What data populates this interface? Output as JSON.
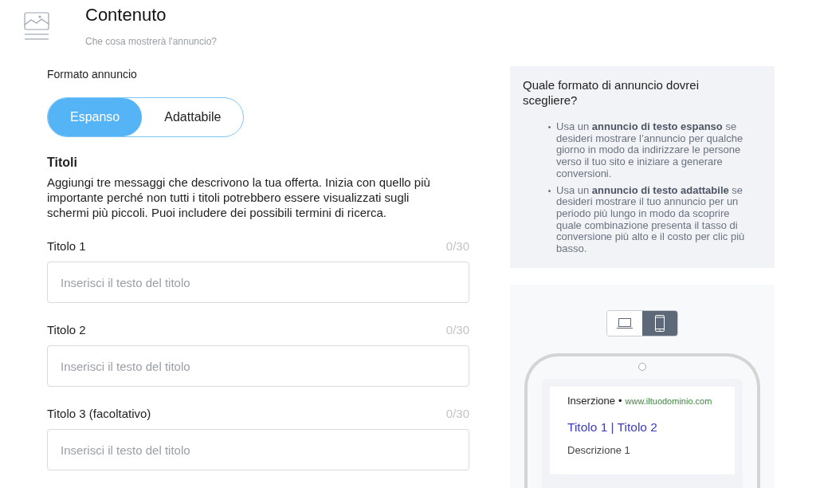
{
  "header": {
    "title": "Contenuto",
    "subtitle": "Che cosa mostrerà l'annuncio?"
  },
  "format": {
    "label": "Formato annuncio",
    "options": [
      {
        "label": "Espanso",
        "selected": true
      },
      {
        "label": "Adattabile",
        "selected": false
      }
    ]
  },
  "headlines": {
    "title": "Titoli",
    "description": "Aggiungi tre messaggi che descrivono la tua offerta. Inizia con quello più importante perché non tutti i titoli potrebbero essere visualizzati sugli schermi più piccoli. Puoi includere dei possibili termini di ricerca.",
    "fields": [
      {
        "label": "Titolo 1",
        "counter": "0/30",
        "placeholder": "Inserisci il testo del titolo"
      },
      {
        "label": "Titolo 2",
        "counter": "0/30",
        "placeholder": "Inserisci il testo del titolo"
      },
      {
        "label": "Titolo 3 (facoltativo)",
        "counter": "0/30",
        "placeholder": "Inserisci il testo del titolo"
      }
    ]
  },
  "help": {
    "title": "Quale formato di annuncio dovrei scegliere?",
    "items": [
      "Usa un **annuncio di testo espanso** se desideri mostrare l’annuncio per qualche giorno in modo da indirizzare le persone verso il tuo sito e iniziare a generare conversioni.",
      "Usa un **annuncio di testo adattabile** se desideri mostrare il tuo annuncio per un periodo più lungo in modo da scoprire quale combinazione presenta il tasso di conversione più alto e il costo per clic più basso."
    ]
  },
  "preview": {
    "devices": [
      {
        "kind": "laptop",
        "selected": false
      },
      {
        "kind": "phone",
        "selected": true
      }
    ],
    "ad": {
      "label": "Inserzione",
      "separator": "•",
      "url": "www.iltuodominio.com",
      "headline": "Titolo 1 | Titolo 2",
      "description": "Descrizione 1"
    }
  }
}
